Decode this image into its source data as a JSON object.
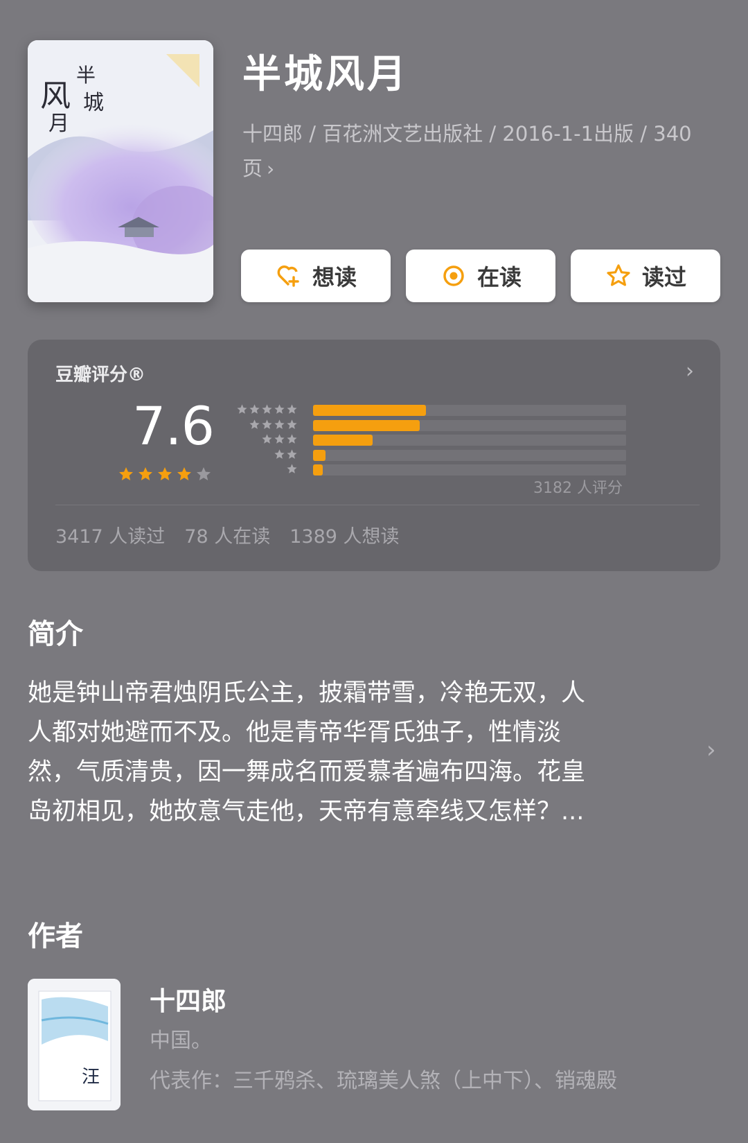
{
  "book": {
    "title": "半城风月",
    "meta_line1": "十四郎 / 百花洲文艺出版社 / 2016-1-1出版 / 340",
    "meta_line2": "页",
    "cover_icon": "book-cover-image"
  },
  "actions": {
    "want_label": "想读",
    "reading_label": "在读",
    "read_label": "读过"
  },
  "rating": {
    "label": "豆瓣评分®",
    "score": "7.6",
    "stars": 4,
    "max_stars": 5,
    "distribution": [
      {
        "stars": 5,
        "fraction": 0.36
      },
      {
        "stars": 4,
        "fraction": 0.34
      },
      {
        "stars": 3,
        "fraction": 0.19
      },
      {
        "stars": 2,
        "fraction": 0.04
      },
      {
        "stars": 1,
        "fraction": 0.03
      }
    ],
    "count_text": "3182 人评分",
    "stats": {
      "read": "3417 人读过",
      "reading": "78 人在读",
      "want": "1389 人想读"
    },
    "accent_color": "#f59f0f"
  },
  "intro": {
    "title": "简介",
    "lines": [
      "她是钟山帝君烛阴氏公主，披霜带雪，冷艳无双，人",
      "人都对她避而不及。他是青帝华胥氏独子，性情淡",
      "然，气质清贵，因一舞成名而爱慕者遍布四海。花皇",
      "岛初相见，她故意气走他，天帝有意牵线又怎样？..."
    ]
  },
  "author": {
    "section_title": "作者",
    "name": "十四郎",
    "country": "中国。",
    "works": "代表作：三千鸦杀、琉璃美人煞（上中下）、销魂殿"
  }
}
